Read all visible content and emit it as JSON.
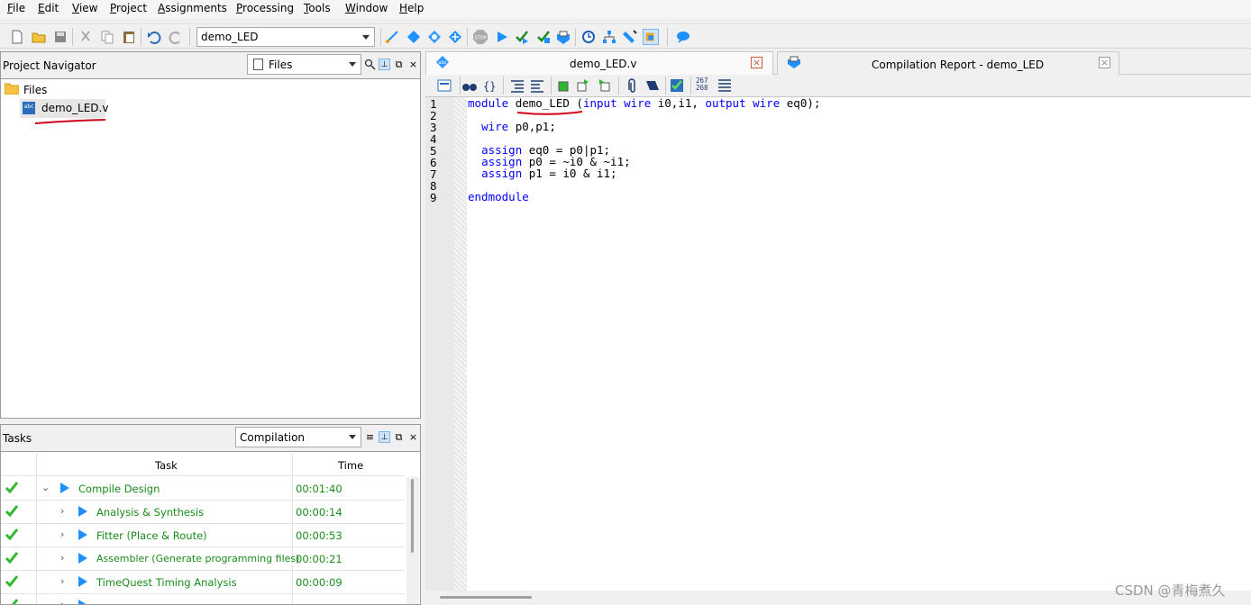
{
  "menu": [
    "File",
    "Edit",
    "View",
    "Project",
    "Assignments",
    "Processing",
    "Tools",
    "Window",
    "Help"
  ],
  "toolbar": {
    "entity_combo_value": "demo_LED"
  },
  "navigator": {
    "title": "Project Navigator",
    "view_combo_value": "Files",
    "folder_label": "Files",
    "file_label": "demo_LED.v"
  },
  "tasks": {
    "title": "Tasks",
    "flow_combo_value": "Compilation",
    "col_task": "Task",
    "col_time": "Time",
    "rows": [
      {
        "task": "Compile Design",
        "time": "00:01:40"
      },
      {
        "task": "Analysis & Synthesis",
        "time": "00:00:14"
      },
      {
        "task": "Fitter (Place & Route)",
        "time": "00:00:53"
      },
      {
        "task": "Assembler (Generate programming files)",
        "time": "00:00:21"
      },
      {
        "task": "TimeQuest Timing Analysis",
        "time": "00:00:09"
      }
    ]
  },
  "editor": {
    "tab_active": "demo_LED.v",
    "tab_report": "Compilation Report - demo_LED",
    "line_numbers": [
      "1",
      "2",
      "3",
      "4",
      "5",
      "6",
      "7",
      "8",
      "9"
    ],
    "code": {
      "l1_kw1": "module",
      "l1_name": "demo_LED",
      "l1_rest_a": " (",
      "l1_kw2": "input wire",
      "l1_rest_b": " i0,i1, ",
      "l1_kw3": "output wire",
      "l1_rest_c": " eq0);",
      "l3_kw": "wire",
      "l3_rest": " p0,p1;",
      "l5_kw": "assign",
      "l5_rest": " eq0 = p0|p1;",
      "l6_kw": "assign",
      "l6_rest": " p0 = ~i0 & ~i1;",
      "l7_kw": "assign",
      "l7_rest": " p1 = i0 & i1;",
      "l9_kw": "endmodule"
    },
    "ruler_top": "267",
    "ruler_bottom": "268"
  },
  "watermark": "CSDN @青梅煮久",
  "colors": {
    "keyword": "#0000ff",
    "task_green": "#1a8c1a",
    "play_blue": "#1e90ff",
    "annotation_red": "#d0021b"
  }
}
